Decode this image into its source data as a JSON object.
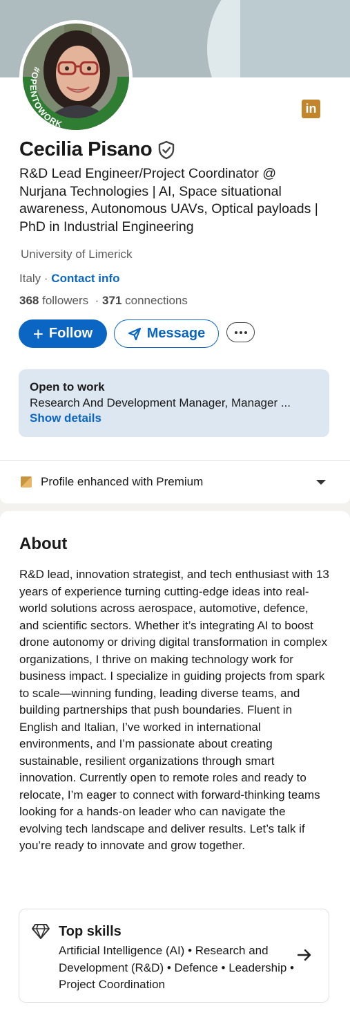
{
  "profile": {
    "name": "Cecilia Pisano",
    "headline": "R&D Lead Engineer/Project Coordinator @ Nurjana Technologies | AI, Space situational awareness, Autonomous UAVs, Optical payloads | PhD in Industrial Engineering",
    "school": "University of Limerick",
    "location": "Italy",
    "location_sep": " · ",
    "contact_info": "Contact info",
    "followers_count": "368",
    "followers_label": " followers",
    "stats_sep": "  · ",
    "connections_count": "371",
    "connections_label": " connections",
    "avatar_frame_text": "#OPENTOWORK",
    "badge_logo": "in"
  },
  "actions": {
    "follow_icon": "+",
    "follow_label": "Follow",
    "message_label": "Message"
  },
  "open_to_work": {
    "title": "Open to work",
    "roles": "Research And Development Manager, Manager ...",
    "link": "Show details"
  },
  "premium": {
    "label": "Profile enhanced with Premium"
  },
  "about": {
    "heading": "About",
    "text": "R&D lead, innovation strategist, and tech enthusiast with 13 years of experience turning cutting-edge ideas into real-world solutions across aerospace, automotive, defence, and scientific sectors. Whether it’s integrating AI to boost drone autonomy or driving digital transformation in complex organizations, I thrive on making technology work for business impact. I specialize in guiding projects from spark to scale—winning funding, leading diverse teams, and building partnerships that push boundaries. Fluent in English and Italian, I’ve worked in international environments, and I’m passionate about creating sustainable, resilient organizations through smart innovation. Currently open to remote roles and ready to relocate, I’m eager to connect with forward-thinking teams looking for a hands-on leader who can navigate the evolving tech landscape and deliver results. Let’s talk if you’re ready to innovate and grow together."
  },
  "top_skills": {
    "heading": "Top skills",
    "skills": "Artificial Intelligence (AI) • Research and Development (R&D) • Defence • Leadership • Project Coordination"
  },
  "colors": {
    "brand_blue": "#0a66c2",
    "open_to_work_green": "#2e7d32",
    "premium_gold": "#e8b769",
    "linkedin_badge": "#c3852c"
  },
  "icons": [
    "verified-shield-icon",
    "linkedin-icon",
    "plus-icon",
    "send-icon",
    "more-icon",
    "premium-icon",
    "chevron-down-icon",
    "diamond-icon",
    "arrow-right-icon"
  ]
}
